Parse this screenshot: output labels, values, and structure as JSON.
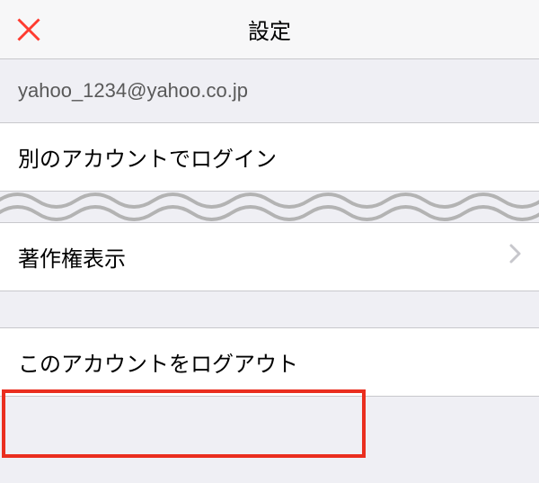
{
  "header": {
    "title": "設定"
  },
  "account": {
    "email": "yahoo_1234@yahoo.co.jp"
  },
  "rows": {
    "login_other": "別のアカウントでログイン",
    "copyright": "著作権表示",
    "logout": "このアカウントをログアウト"
  }
}
